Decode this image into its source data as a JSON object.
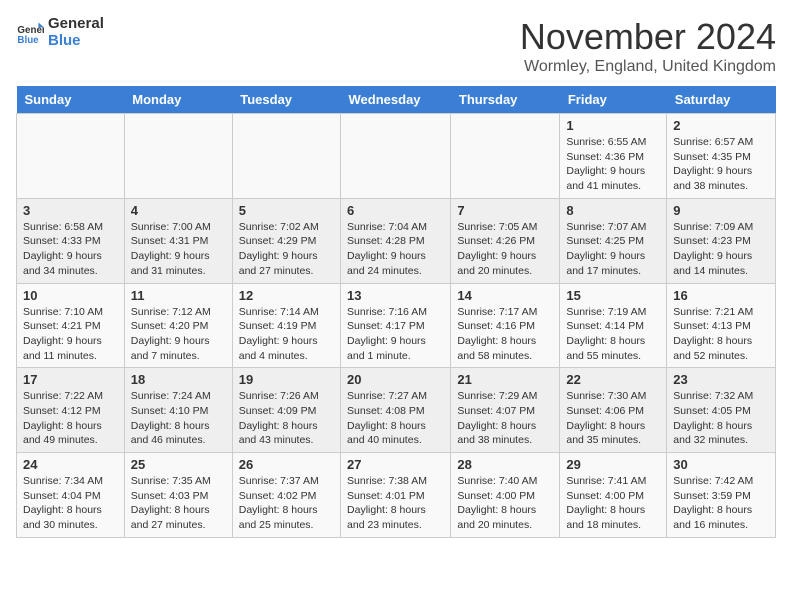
{
  "header": {
    "logo_line1": "General",
    "logo_line2": "Blue",
    "month_title": "November 2024",
    "location": "Wormley, England, United Kingdom"
  },
  "weekdays": [
    "Sunday",
    "Monday",
    "Tuesday",
    "Wednesday",
    "Thursday",
    "Friday",
    "Saturday"
  ],
  "weeks": [
    [
      {
        "day": "",
        "info": ""
      },
      {
        "day": "",
        "info": ""
      },
      {
        "day": "",
        "info": ""
      },
      {
        "day": "",
        "info": ""
      },
      {
        "day": "",
        "info": ""
      },
      {
        "day": "1",
        "info": "Sunrise: 6:55 AM\nSunset: 4:36 PM\nDaylight: 9 hours and 41 minutes."
      },
      {
        "day": "2",
        "info": "Sunrise: 6:57 AM\nSunset: 4:35 PM\nDaylight: 9 hours and 38 minutes."
      }
    ],
    [
      {
        "day": "3",
        "info": "Sunrise: 6:58 AM\nSunset: 4:33 PM\nDaylight: 9 hours and 34 minutes."
      },
      {
        "day": "4",
        "info": "Sunrise: 7:00 AM\nSunset: 4:31 PM\nDaylight: 9 hours and 31 minutes."
      },
      {
        "day": "5",
        "info": "Sunrise: 7:02 AM\nSunset: 4:29 PM\nDaylight: 9 hours and 27 minutes."
      },
      {
        "day": "6",
        "info": "Sunrise: 7:04 AM\nSunset: 4:28 PM\nDaylight: 9 hours and 24 minutes."
      },
      {
        "day": "7",
        "info": "Sunrise: 7:05 AM\nSunset: 4:26 PM\nDaylight: 9 hours and 20 minutes."
      },
      {
        "day": "8",
        "info": "Sunrise: 7:07 AM\nSunset: 4:25 PM\nDaylight: 9 hours and 17 minutes."
      },
      {
        "day": "9",
        "info": "Sunrise: 7:09 AM\nSunset: 4:23 PM\nDaylight: 9 hours and 14 minutes."
      }
    ],
    [
      {
        "day": "10",
        "info": "Sunrise: 7:10 AM\nSunset: 4:21 PM\nDaylight: 9 hours and 11 minutes."
      },
      {
        "day": "11",
        "info": "Sunrise: 7:12 AM\nSunset: 4:20 PM\nDaylight: 9 hours and 7 minutes."
      },
      {
        "day": "12",
        "info": "Sunrise: 7:14 AM\nSunset: 4:19 PM\nDaylight: 9 hours and 4 minutes."
      },
      {
        "day": "13",
        "info": "Sunrise: 7:16 AM\nSunset: 4:17 PM\nDaylight: 9 hours and 1 minute."
      },
      {
        "day": "14",
        "info": "Sunrise: 7:17 AM\nSunset: 4:16 PM\nDaylight: 8 hours and 58 minutes."
      },
      {
        "day": "15",
        "info": "Sunrise: 7:19 AM\nSunset: 4:14 PM\nDaylight: 8 hours and 55 minutes."
      },
      {
        "day": "16",
        "info": "Sunrise: 7:21 AM\nSunset: 4:13 PM\nDaylight: 8 hours and 52 minutes."
      }
    ],
    [
      {
        "day": "17",
        "info": "Sunrise: 7:22 AM\nSunset: 4:12 PM\nDaylight: 8 hours and 49 minutes."
      },
      {
        "day": "18",
        "info": "Sunrise: 7:24 AM\nSunset: 4:10 PM\nDaylight: 8 hours and 46 minutes."
      },
      {
        "day": "19",
        "info": "Sunrise: 7:26 AM\nSunset: 4:09 PM\nDaylight: 8 hours and 43 minutes."
      },
      {
        "day": "20",
        "info": "Sunrise: 7:27 AM\nSunset: 4:08 PM\nDaylight: 8 hours and 40 minutes."
      },
      {
        "day": "21",
        "info": "Sunrise: 7:29 AM\nSunset: 4:07 PM\nDaylight: 8 hours and 38 minutes."
      },
      {
        "day": "22",
        "info": "Sunrise: 7:30 AM\nSunset: 4:06 PM\nDaylight: 8 hours and 35 minutes."
      },
      {
        "day": "23",
        "info": "Sunrise: 7:32 AM\nSunset: 4:05 PM\nDaylight: 8 hours and 32 minutes."
      }
    ],
    [
      {
        "day": "24",
        "info": "Sunrise: 7:34 AM\nSunset: 4:04 PM\nDaylight: 8 hours and 30 minutes."
      },
      {
        "day": "25",
        "info": "Sunrise: 7:35 AM\nSunset: 4:03 PM\nDaylight: 8 hours and 27 minutes."
      },
      {
        "day": "26",
        "info": "Sunrise: 7:37 AM\nSunset: 4:02 PM\nDaylight: 8 hours and 25 minutes."
      },
      {
        "day": "27",
        "info": "Sunrise: 7:38 AM\nSunset: 4:01 PM\nDaylight: 8 hours and 23 minutes."
      },
      {
        "day": "28",
        "info": "Sunrise: 7:40 AM\nSunset: 4:00 PM\nDaylight: 8 hours and 20 minutes."
      },
      {
        "day": "29",
        "info": "Sunrise: 7:41 AM\nSunset: 4:00 PM\nDaylight: 8 hours and 18 minutes."
      },
      {
        "day": "30",
        "info": "Sunrise: 7:42 AM\nSunset: 3:59 PM\nDaylight: 8 hours and 16 minutes."
      }
    ]
  ]
}
